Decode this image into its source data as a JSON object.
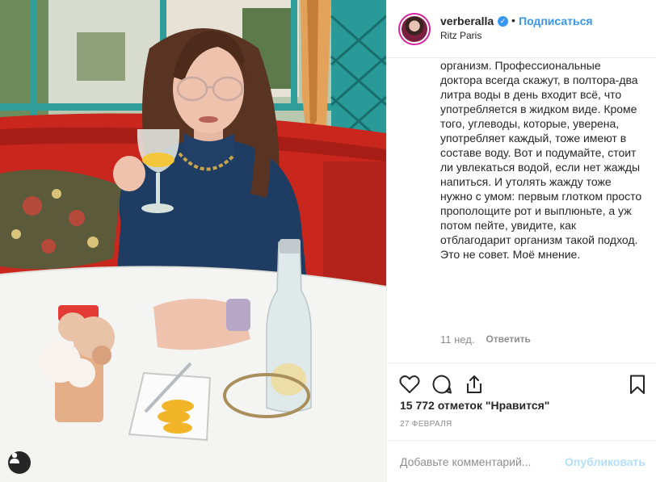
{
  "header": {
    "username": "verberalla",
    "verified_mark": "✓",
    "separator": "•",
    "follow_label": "Подписаться",
    "location": "Ritz Paris"
  },
  "caption": {
    "text": "организм. Профессиональные доктора всегда скажут, в полтора-два литра воды в день входит всё, что употребляется в жидком виде. Кроме того, углеводы, которые, уверена, употребляет каждый, тоже имеют в составе воду. Вот и подумайте, стоит ли увлекаться водой, если нет жажды напиться. И утолять жажду тоже нужно с умом: первым глотком просто прополощите рот и выплюньте, а уж потом пейте, увидите, как отблагодарит организм такой подход. Это не совет. Моё мнение."
  },
  "comment_meta": {
    "time_ago": "11 нед.",
    "reply_label": "Ответить"
  },
  "actions": {
    "icons": [
      "heart-icon",
      "comment-icon",
      "share-icon",
      "bookmark-icon"
    ]
  },
  "likes": "15 772 отметок \"Нравится\"",
  "date": "27 ФЕВРАЛЯ",
  "comment_bar": {
    "placeholder": "Добавьте комментарий...",
    "publish_label": "Опубликовать"
  },
  "photo": {
    "user_tag_icon": "user-icon"
  },
  "colors": {
    "link": "#3897f0",
    "publish_disabled": "#b2dffc",
    "muted": "#8e8e8e",
    "text": "#262626"
  }
}
